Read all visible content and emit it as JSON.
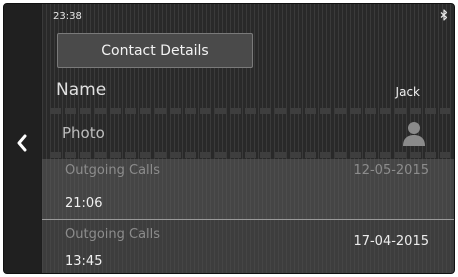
{
  "status": {
    "time": "23:38",
    "bluetooth_icon": "bluetooth-icon"
  },
  "navigation": {
    "back_icon": "chevron-left-icon"
  },
  "header": {
    "title": "Contact Details"
  },
  "contact": {
    "name_label": "Name",
    "name_value": "Jack",
    "photo_label": "Photo",
    "photo_icon": "person-silhouette-icon"
  },
  "calls": [
    {
      "type": "Outgoing Calls",
      "date": "12-05-2015",
      "time": "21:06"
    },
    {
      "type": "Outgoing Calls",
      "date": "17-04-2015",
      "time": "13:45"
    }
  ],
  "colors": {
    "background": "#292929",
    "row_highlight": "#5c5c5c",
    "text_primary": "#f0f0f0",
    "text_muted": "#8c8c8c"
  }
}
